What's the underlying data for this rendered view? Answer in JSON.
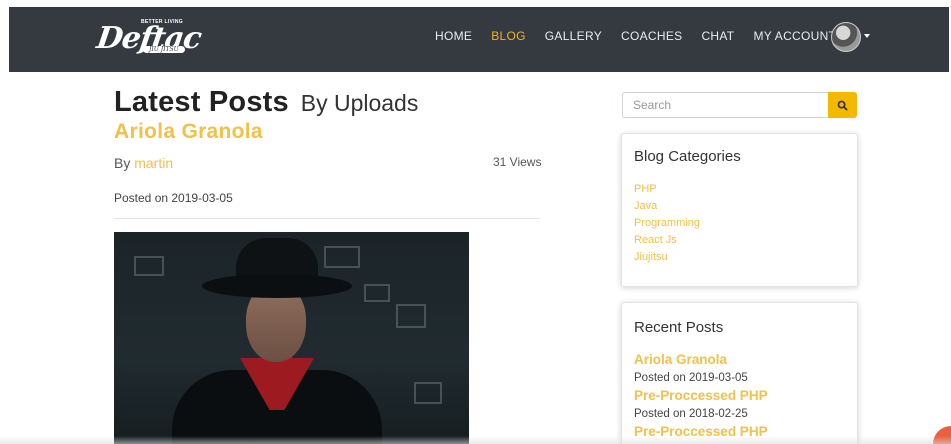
{
  "brand": {
    "tagline": "BETTER LIVING",
    "name": "Deftac",
    "sub": "JIU JITSU"
  },
  "nav": {
    "items": [
      {
        "label": "HOME",
        "active": false
      },
      {
        "label": "BLOG",
        "active": true
      },
      {
        "label": "GALLERY",
        "active": false
      },
      {
        "label": "COACHES",
        "active": false
      },
      {
        "label": "CHAT",
        "active": false
      },
      {
        "label": "MY ACCOUNT",
        "active": false
      }
    ],
    "active_color": "#f0b323"
  },
  "heading": {
    "strong": "Latest Posts",
    "light": "By Uploads"
  },
  "post": {
    "title": "Ariola Granola",
    "by_prefix": "By",
    "author": "martin",
    "views": "31 Views",
    "posted": "Posted on 2019-03-05"
  },
  "sidebar": {
    "search_placeholder": "Search",
    "categories_title": "Blog Categories",
    "categories": [
      "PHP",
      "Java",
      "Programming",
      "React Js",
      "Jiujitsu"
    ],
    "recent_title": "Recent Posts",
    "recent_posts": [
      {
        "title": "Ariola Granola",
        "date": "Posted on 2019-03-05"
      },
      {
        "title": "Pre-Proccessed PHP",
        "date": "Posted on 2018-02-25"
      },
      {
        "title": "Pre-Proccessed PHP",
        "date": ""
      }
    ]
  },
  "colors": {
    "navbar": "#343a40",
    "accent": "#f0c14b",
    "search_button": "#f5b800"
  }
}
